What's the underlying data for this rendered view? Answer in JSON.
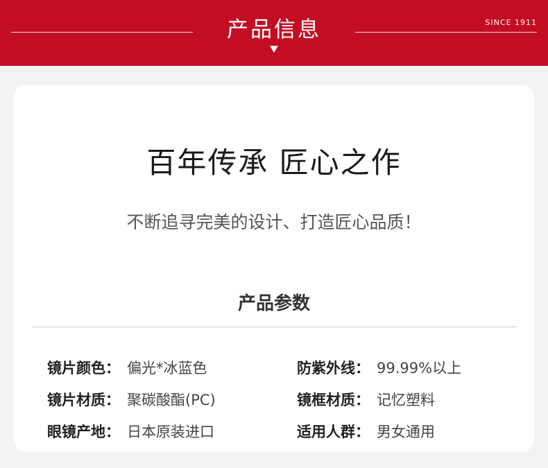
{
  "banner": {
    "title": "产品信息",
    "since": "SINCE 1911",
    "color": "#c30d23"
  },
  "card": {
    "headline": "百年传承  匠心之作",
    "subline": "不断追寻完美的设计、打造匠心品质！"
  },
  "params": {
    "title": "产品参数",
    "rows": [
      {
        "label": "镜片颜色：",
        "value": "偏光*冰蓝色"
      },
      {
        "label": "防紫外线：",
        "value": "99.99%以上"
      },
      {
        "label": "镜片材质：",
        "value": "聚碳酸酯(PC)"
      },
      {
        "label": "镜框材质：",
        "value": "记忆塑料"
      },
      {
        "label": "眼镜产地：",
        "value": "日本原装进口"
      },
      {
        "label": "适用人群：",
        "value": "男女通用"
      }
    ]
  }
}
